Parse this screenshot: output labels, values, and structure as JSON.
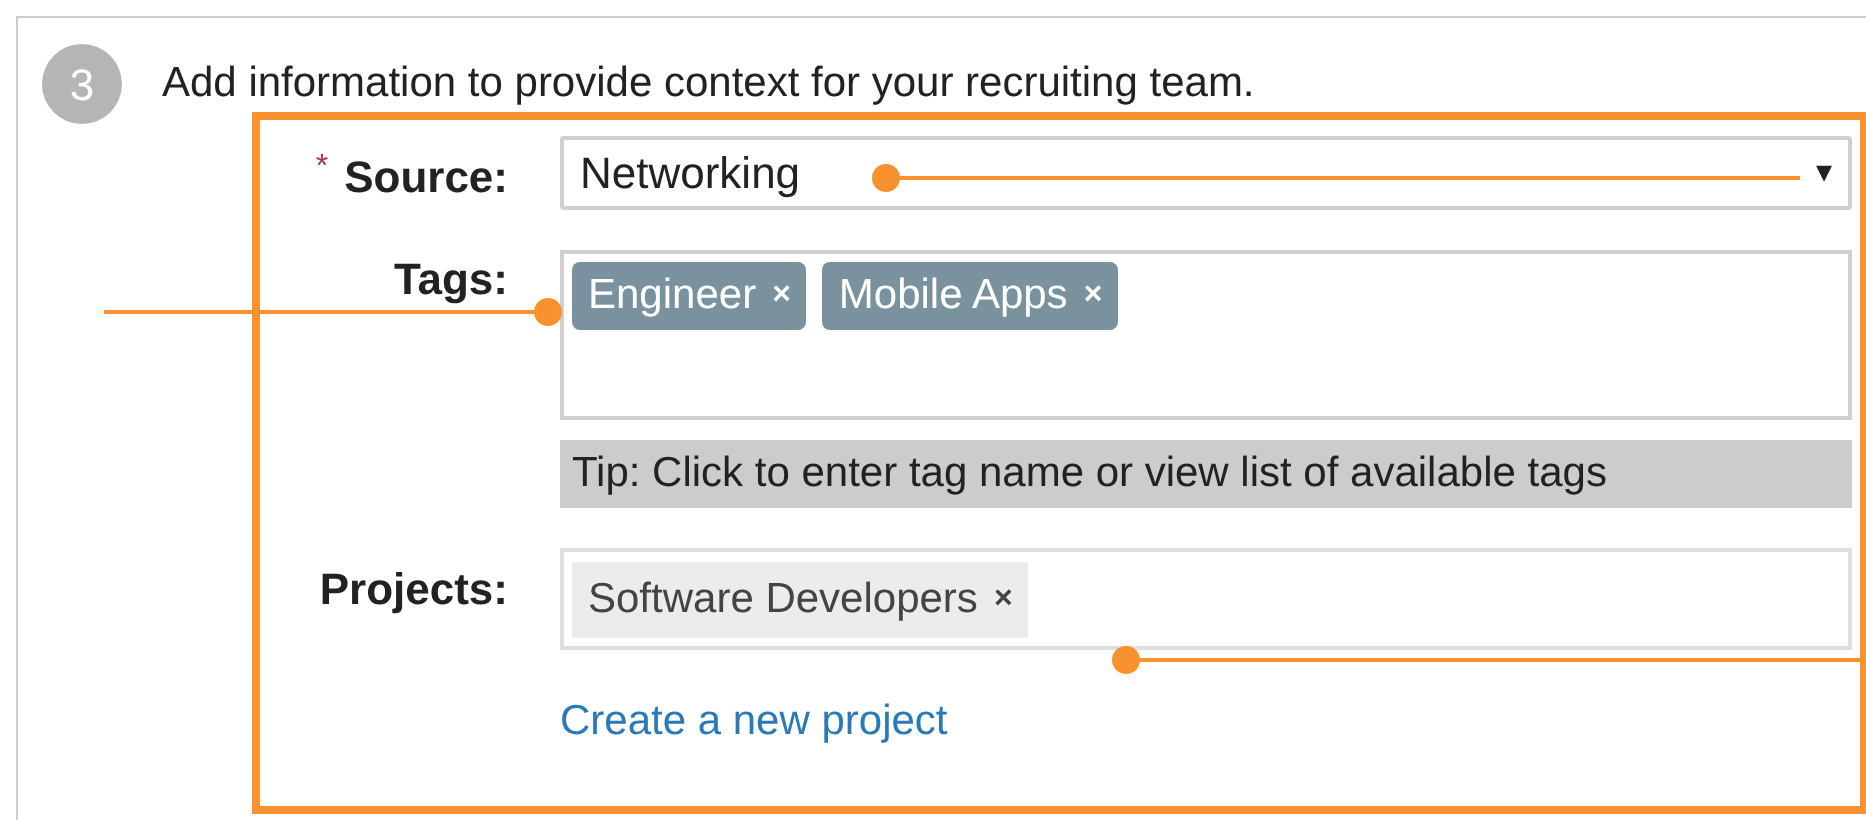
{
  "step": {
    "number": "3",
    "text": "Add information to provide context for your recruiting team."
  },
  "source": {
    "required_mark": "*",
    "label": "Source:",
    "value": "Networking",
    "caret": "▾"
  },
  "tags": {
    "label": "Tags:",
    "items": [
      {
        "label": "Engineer",
        "remove": "×"
      },
      {
        "label": "Mobile Apps",
        "remove": "×"
      }
    ],
    "tip": "Tip: Click to enter tag name or view list of available tags"
  },
  "projects": {
    "label": "Projects:",
    "items": [
      {
        "label": "Software Developers",
        "remove": "×"
      }
    ],
    "link": "Create a new project"
  }
}
